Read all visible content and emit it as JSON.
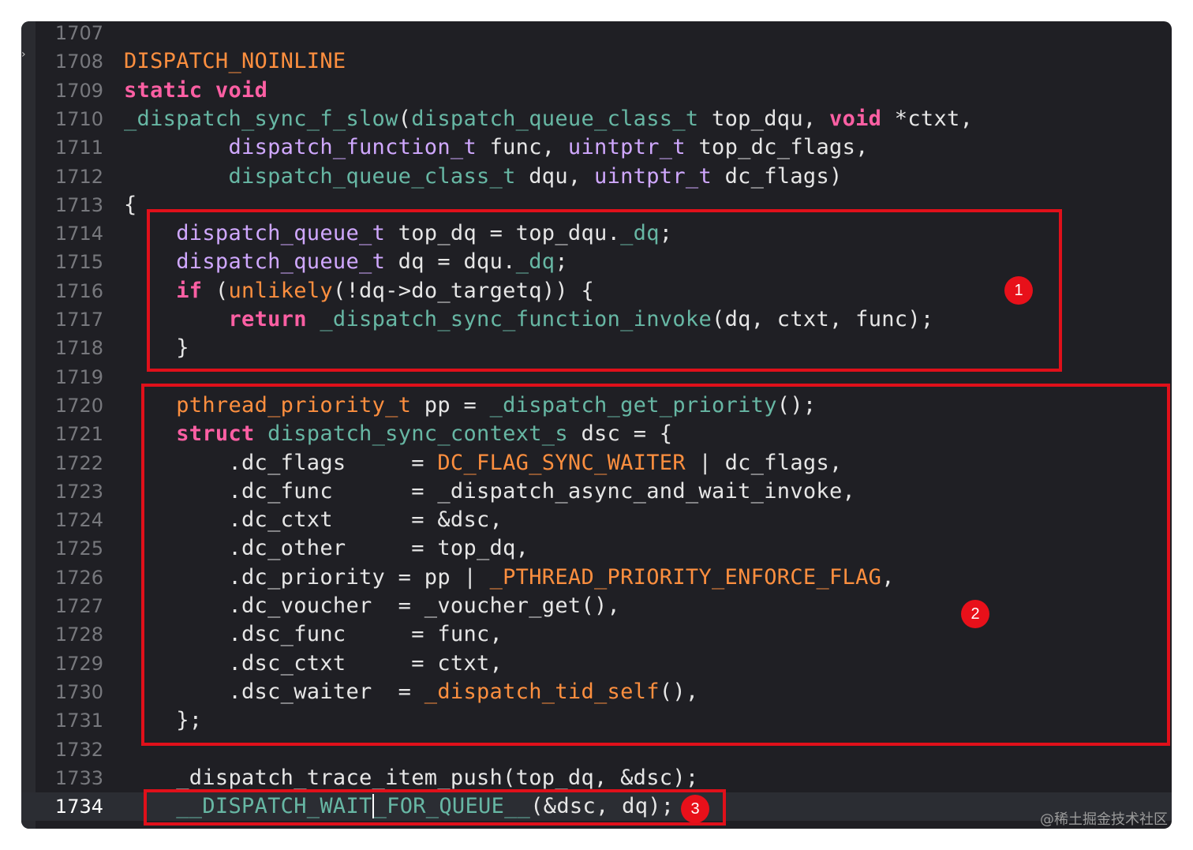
{
  "editor": {
    "left_strip_handle": "›",
    "lines": [
      {
        "num": "1707",
        "tokens": []
      },
      {
        "num": "1708",
        "tokens": [
          {
            "t": "DISPATCH_NOINLINE",
            "c": "mac"
          }
        ]
      },
      {
        "num": "1709",
        "tokens": [
          {
            "t": "static",
            "c": "kw"
          },
          {
            "t": " "
          },
          {
            "t": "void",
            "c": "kw"
          }
        ]
      },
      {
        "num": "1710",
        "tokens": [
          {
            "t": "_dispatch_sync_f_slow",
            "c": "fn"
          },
          {
            "t": "("
          },
          {
            "t": "dispatch_queue_class_t",
            "c": "fn"
          },
          {
            "t": " top_dqu, "
          },
          {
            "t": "void",
            "c": "kw"
          },
          {
            "t": " *ctxt,"
          }
        ]
      },
      {
        "num": "1711",
        "tokens": [
          {
            "t": "        "
          },
          {
            "t": "dispatch_function_t",
            "c": "typ"
          },
          {
            "t": " func, "
          },
          {
            "t": "uintptr_t",
            "c": "typ"
          },
          {
            "t": " top_dc_flags,"
          }
        ]
      },
      {
        "num": "1712",
        "tokens": [
          {
            "t": "        "
          },
          {
            "t": "dispatch_queue_class_t",
            "c": "fn"
          },
          {
            "t": " dqu, "
          },
          {
            "t": "uintptr_t",
            "c": "typ"
          },
          {
            "t": " dc_flags)"
          }
        ]
      },
      {
        "num": "1713",
        "tokens": [
          {
            "t": "{"
          }
        ]
      },
      {
        "num": "1714",
        "tokens": [
          {
            "t": "    "
          },
          {
            "t": "dispatch_queue_t",
            "c": "typ"
          },
          {
            "t": " top_dq = top_dqu."
          },
          {
            "t": "_dq",
            "c": "fn"
          },
          {
            "t": ";"
          }
        ]
      },
      {
        "num": "1715",
        "tokens": [
          {
            "t": "    "
          },
          {
            "t": "dispatch_queue_t",
            "c": "typ"
          },
          {
            "t": " dq = dqu."
          },
          {
            "t": "_dq",
            "c": "fn"
          },
          {
            "t": ";"
          }
        ]
      },
      {
        "num": "1716",
        "tokens": [
          {
            "t": "    "
          },
          {
            "t": "if",
            "c": "kw"
          },
          {
            "t": " ("
          },
          {
            "t": "unlikely",
            "c": "mac"
          },
          {
            "t": "(!dq->do_targetq)) {"
          }
        ]
      },
      {
        "num": "1717",
        "tokens": [
          {
            "t": "        "
          },
          {
            "t": "return",
            "c": "kw"
          },
          {
            "t": " "
          },
          {
            "t": "_dispatch_sync_function_invoke",
            "c": "fn"
          },
          {
            "t": "(dq, ctxt, func);"
          }
        ]
      },
      {
        "num": "1718",
        "tokens": [
          {
            "t": "    }"
          }
        ]
      },
      {
        "num": "1719",
        "tokens": []
      },
      {
        "num": "1720",
        "tokens": [
          {
            "t": "    "
          },
          {
            "t": "pthread_priority_t",
            "c": "mac"
          },
          {
            "t": " pp = "
          },
          {
            "t": "_dispatch_get_priority",
            "c": "fn"
          },
          {
            "t": "();"
          }
        ]
      },
      {
        "num": "1721",
        "tokens": [
          {
            "t": "    "
          },
          {
            "t": "struct",
            "c": "kw"
          },
          {
            "t": " "
          },
          {
            "t": "dispatch_sync_context_s",
            "c": "fn"
          },
          {
            "t": " dsc = {"
          }
        ]
      },
      {
        "num": "1722",
        "tokens": [
          {
            "t": "        .dc_flags     = "
          },
          {
            "t": "DC_FLAG_SYNC_WAITER",
            "c": "mac"
          },
          {
            "t": " | dc_flags,"
          }
        ]
      },
      {
        "num": "1723",
        "tokens": [
          {
            "t": "        .dc_func      = _dispatch_async_and_wait_invoke,"
          }
        ]
      },
      {
        "num": "1724",
        "tokens": [
          {
            "t": "        .dc_ctxt      = &dsc,"
          }
        ]
      },
      {
        "num": "1725",
        "tokens": [
          {
            "t": "        .dc_other     = top_dq,"
          }
        ]
      },
      {
        "num": "1726",
        "tokens": [
          {
            "t": "        .dc_priority = pp | "
          },
          {
            "t": "_PTHREAD_PRIORITY_ENFORCE_FLAG",
            "c": "mac"
          },
          {
            "t": ","
          }
        ]
      },
      {
        "num": "1727",
        "tokens": [
          {
            "t": "        .dc_voucher  = _voucher_get(),"
          }
        ]
      },
      {
        "num": "1728",
        "tokens": [
          {
            "t": "        .dsc_func     = func,"
          }
        ]
      },
      {
        "num": "1729",
        "tokens": [
          {
            "t": "        .dsc_ctxt     = ctxt,"
          }
        ]
      },
      {
        "num": "1730",
        "tokens": [
          {
            "t": "        .dsc_waiter  = "
          },
          {
            "t": "_dispatch_tid_self",
            "c": "mac"
          },
          {
            "t": "(),"
          }
        ]
      },
      {
        "num": "1731",
        "tokens": [
          {
            "t": "    };"
          }
        ]
      },
      {
        "num": "1732",
        "tokens": []
      },
      {
        "num": "1733",
        "tokens": [
          {
            "t": "    _dispatch_trace_item_push(top_dq, &dsc);"
          }
        ]
      },
      {
        "num": "1734",
        "current": true,
        "tokens": [
          {
            "t": "    "
          },
          {
            "t": "__DISPATCH_WAIT",
            "c": "fn"
          },
          {
            "t": "_FOR_QUEUE__",
            "c": "fn caret"
          },
          {
            "t": "(&dsc, dq);"
          }
        ]
      }
    ]
  },
  "annotations": {
    "badge_1": "1",
    "badge_2": "2",
    "badge_3": "3",
    "box_color": "#e0101a"
  },
  "watermark": "@稀土掘金技术社区",
  "colors": {
    "background": "#1f1f24",
    "keyword": "#fc5fa3",
    "macro": "#fd8f3f",
    "type": "#d0a8ff",
    "function": "#67b7a4",
    "plain": "#e6e6e6",
    "line_number": "#77787d"
  }
}
